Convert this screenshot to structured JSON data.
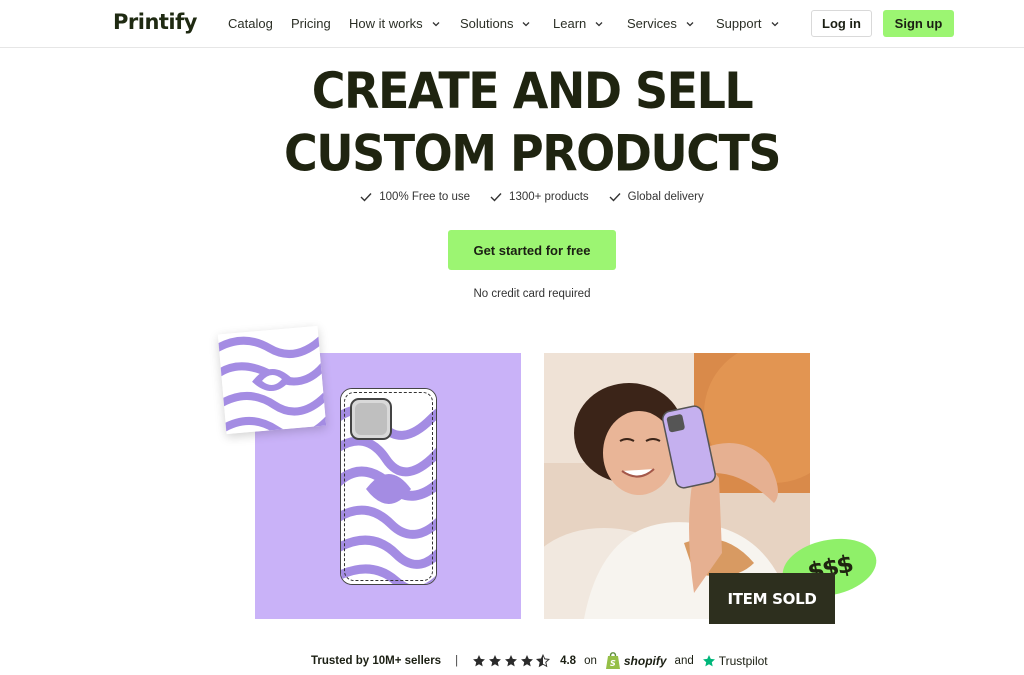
{
  "nav": {
    "logo": "Printify",
    "items": [
      {
        "label": "Catalog",
        "has_dropdown": false
      },
      {
        "label": "Pricing",
        "has_dropdown": false
      },
      {
        "label": "How it works",
        "has_dropdown": true
      },
      {
        "label": "Solutions",
        "has_dropdown": true
      },
      {
        "label": "Learn",
        "has_dropdown": true
      },
      {
        "label": "Services",
        "has_dropdown": true
      },
      {
        "label": "Support",
        "has_dropdown": true
      }
    ],
    "login_label": "Log in",
    "signup_label": "Sign up"
  },
  "hero": {
    "title_line1": "CREATE AND SELL",
    "title_line2": "CUSTOM PRODUCTS",
    "features": [
      "100% Free to use",
      "1300+ products",
      "Global delivery"
    ],
    "cta_label": "Get started for free",
    "note": "No credit card required"
  },
  "showcase": {
    "sold_label": "ITEM SOLD",
    "dollars_label": "$$$"
  },
  "trust": {
    "sellers_text": "Trusted by 10M+ sellers",
    "separator": "|",
    "rating_value": 4.8,
    "rating_max": 5,
    "rating_text": "4.8",
    "on_text": "on",
    "shopify_label": "shopify",
    "and_text": "and",
    "trustpilot_label": "Trustpilot"
  },
  "colors": {
    "accent_green": "#9cf572",
    "lilac": "#c9b2f8",
    "wave_purple": "#a48ce3",
    "dark": "#1f2410",
    "trustpilot_green": "#00b67a",
    "shopify_green": "#95bf47"
  }
}
